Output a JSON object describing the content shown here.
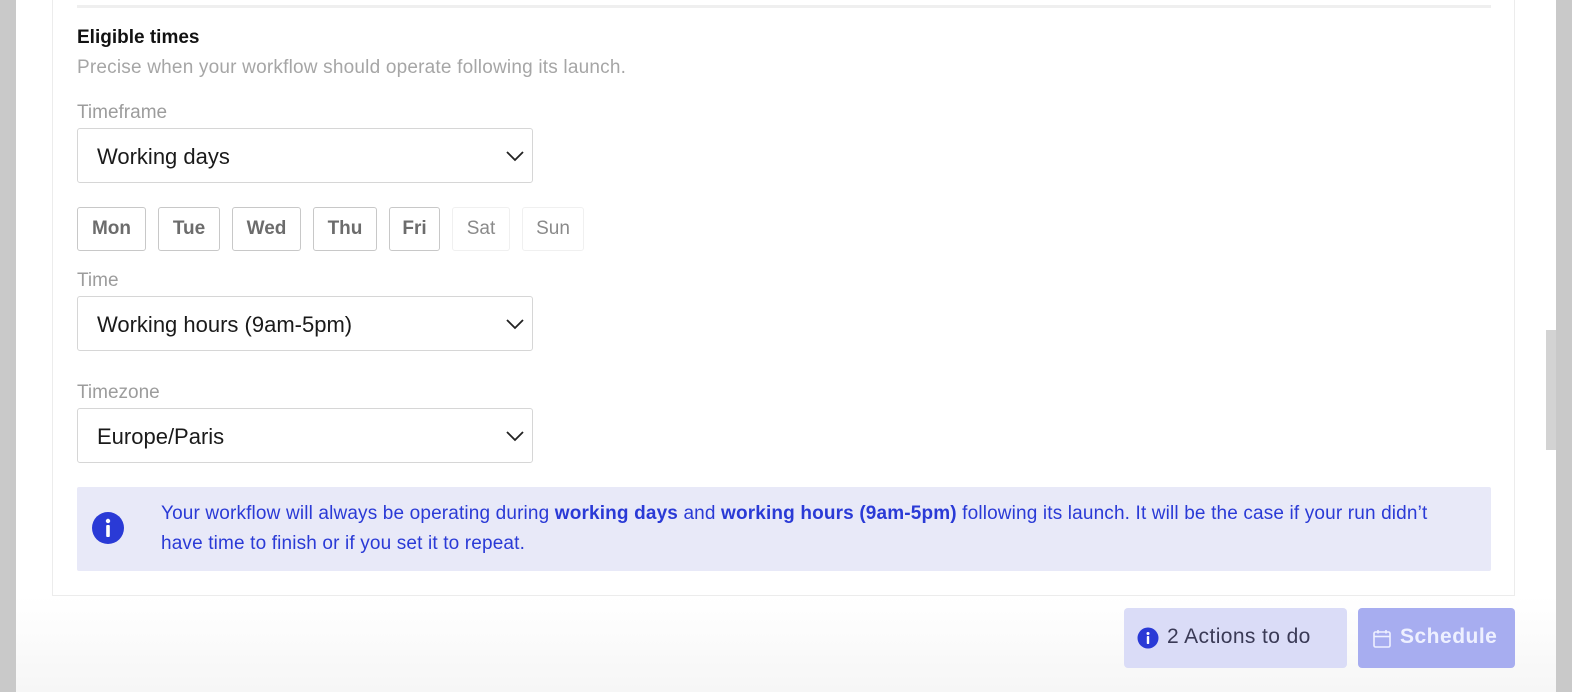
{
  "section": {
    "title": "Eligible times",
    "subtitle": "Precise when your workflow should operate following its launch."
  },
  "timeframe": {
    "label": "Timeframe",
    "value": "Working days"
  },
  "days": [
    {
      "label": "Mon",
      "selected": true
    },
    {
      "label": "Tue",
      "selected": true
    },
    {
      "label": "Wed",
      "selected": true
    },
    {
      "label": "Thu",
      "selected": true
    },
    {
      "label": "Fri",
      "selected": true
    },
    {
      "label": "Sat",
      "selected": false
    },
    {
      "label": "Sun",
      "selected": false
    }
  ],
  "time": {
    "label": "Time",
    "value": "Working hours (9am-5pm)"
  },
  "timezone": {
    "label": "Timezone",
    "value": "Europe/Paris"
  },
  "info": {
    "icon": "info-circle-icon",
    "text_1": "Your workflow will always be operating during ",
    "bold_1": "working days",
    "text_2": " and ",
    "bold_2": "working hours (9am-5pm)",
    "text_3": " following its launch. It will be the case if your run didn’t have time to finish or if you set it to repeat."
  },
  "footer": {
    "actions_label": "2 Actions to do",
    "schedule_label": "Schedule"
  },
  "colors": {
    "accent": "#2a3ad6",
    "info_bg": "#e8e9f8",
    "actions_bg": "#dadcf7",
    "schedule_bg": "#a7adf0"
  }
}
